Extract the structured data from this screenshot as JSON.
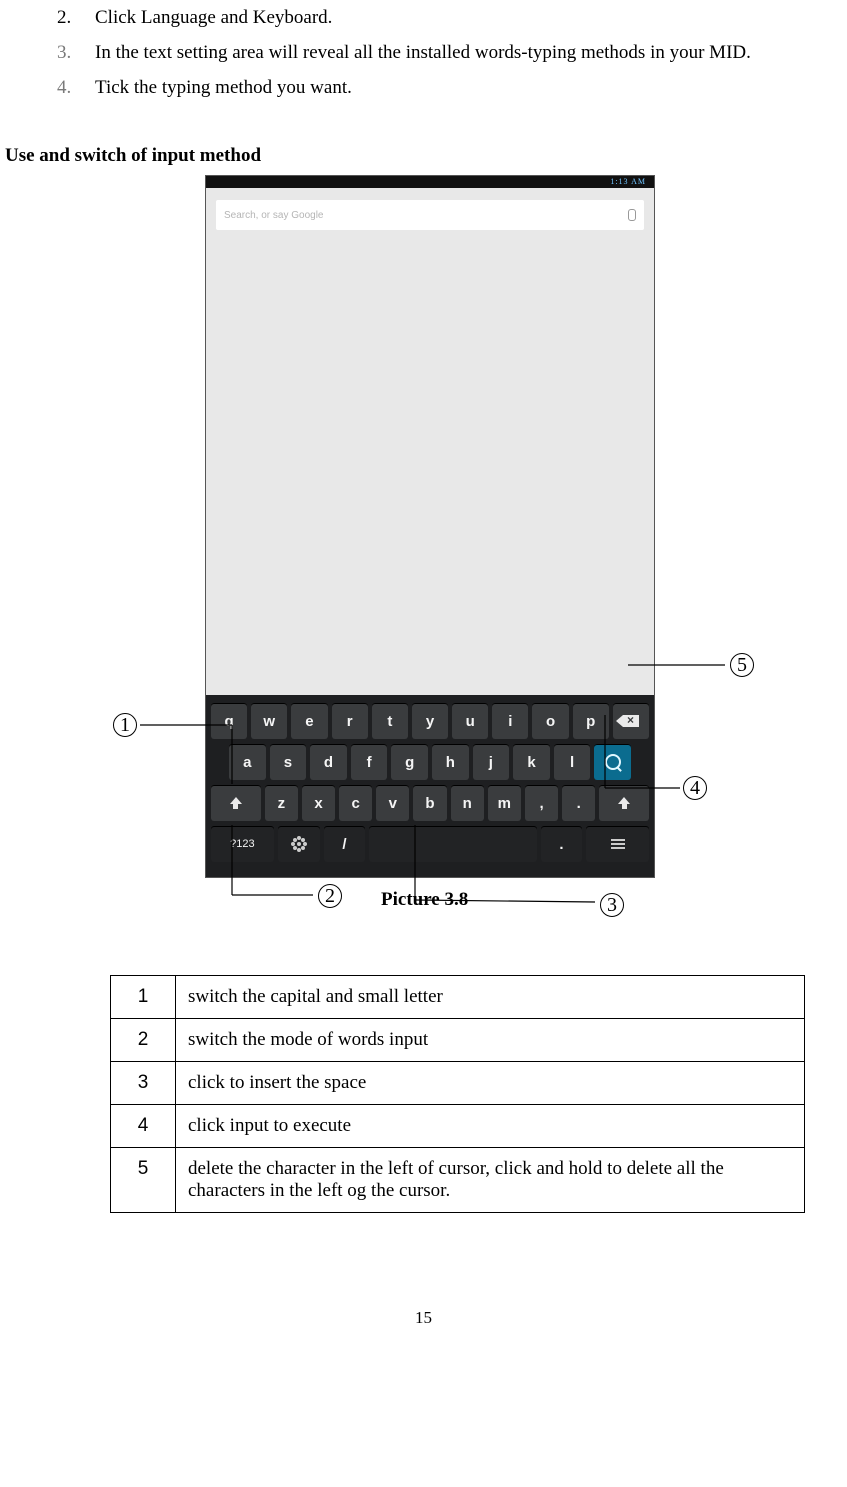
{
  "list": {
    "i2": {
      "num": "2.",
      "text": "Click Language and Keyboard."
    },
    "i3": {
      "num": "3.",
      "text": "In the text setting area will reveal all the installed words-typing methods in your MID."
    },
    "i4": {
      "num": "4.",
      "text": "Tick the typing method you want."
    }
  },
  "section_heading": "Use and switch of input method",
  "phone": {
    "status_time": "1:13 AM",
    "search_placeholder": "Search, or say Google",
    "kbd": {
      "row1": [
        "q",
        "w",
        "e",
        "r",
        "t",
        "y",
        "u",
        "i",
        "o",
        "p"
      ],
      "row2": [
        "a",
        "s",
        "d",
        "f",
        "g",
        "h",
        "j",
        "k",
        "l"
      ],
      "row3": {
        "z": "z",
        "x": "x",
        "c": "c",
        "v": "v",
        "b": "b",
        "n": "n",
        "m": "m",
        "comma": ",",
        "period": "."
      },
      "row4": {
        "mode": "?123",
        "slash": "/"
      }
    }
  },
  "callouts": {
    "c1": "1",
    "c2": "2",
    "c3": "3",
    "c4": "4",
    "c5": "5"
  },
  "caption": "Picture 3.8",
  "legend": {
    "r1": {
      "n": "1",
      "t": "switch the capital and small letter"
    },
    "r2": {
      "n": "2",
      "t": "switch the mode of words input"
    },
    "r3": {
      "n": "3",
      "t": "click to insert the space"
    },
    "r4": {
      "n": "4",
      "t": "click input to execute"
    },
    "r5": {
      "n": "5",
      "t": "delete the character in the left of cursor, click and hold to delete all the characters in the left og the cursor."
    }
  },
  "page_number": "15"
}
